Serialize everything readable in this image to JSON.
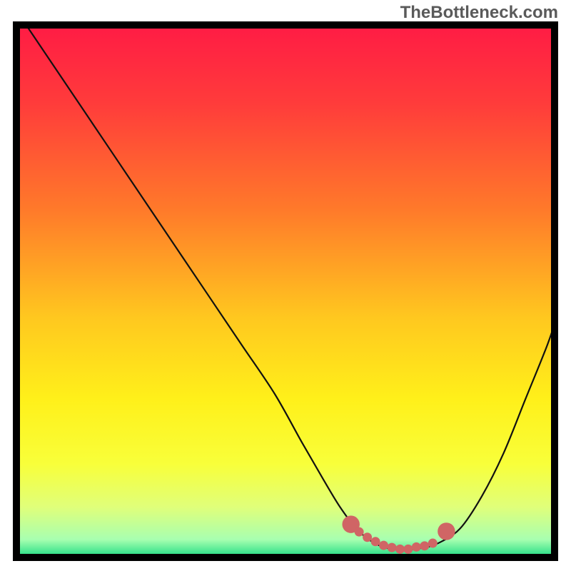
{
  "attribution": "TheBottleneck.com",
  "colors": {
    "gradient_stops": [
      {
        "offset": 0.0,
        "color": "#ff1a45"
      },
      {
        "offset": 0.15,
        "color": "#ff3b3b"
      },
      {
        "offset": 0.35,
        "color": "#ff7a2a"
      },
      {
        "offset": 0.55,
        "color": "#ffc81f"
      },
      {
        "offset": 0.7,
        "color": "#fff01a"
      },
      {
        "offset": 0.82,
        "color": "#f8ff3a"
      },
      {
        "offset": 0.9,
        "color": "#e0ff7a"
      },
      {
        "offset": 0.96,
        "color": "#a8ffb0"
      },
      {
        "offset": 1.0,
        "color": "#00d47a"
      }
    ],
    "frame": "#000000",
    "curve": "#111111",
    "marker": "#d06565",
    "marker_stroke": "#b24e4e"
  },
  "chart_data": {
    "type": "line",
    "title": "",
    "xlabel": "",
    "ylabel": "",
    "xlim": [
      0,
      100
    ],
    "ylim": [
      0,
      100
    ],
    "series": [
      {
        "name": "bottleneck-curve",
        "x": [
          2,
          6,
          12,
          18,
          24,
          30,
          36,
          42,
          48,
          53,
          57,
          60,
          63,
          66,
          69,
          72,
          75,
          78,
          82,
          86,
          90,
          94,
          98,
          100
        ],
        "y": [
          100,
          94,
          85,
          76,
          67,
          58,
          49,
          40,
          31,
          22,
          15,
          10,
          6,
          3.5,
          2.3,
          2.1,
          2.4,
          3.3,
          6,
          12,
          20,
          30,
          40,
          46
        ]
      }
    ],
    "markers": {
      "name": "optimal-range",
      "points": [
        {
          "x": 62.0,
          "y": 6.8
        },
        {
          "x": 63.5,
          "y": 5.4
        },
        {
          "x": 65.0,
          "y": 4.4
        },
        {
          "x": 66.5,
          "y": 3.6
        },
        {
          "x": 68.0,
          "y": 2.9
        },
        {
          "x": 69.5,
          "y": 2.5
        },
        {
          "x": 71.0,
          "y": 2.2
        },
        {
          "x": 72.5,
          "y": 2.2
        },
        {
          "x": 74.0,
          "y": 2.6
        },
        {
          "x": 75.5,
          "y": 2.8
        },
        {
          "x": 77.0,
          "y": 3.3
        },
        {
          "x": 79.5,
          "y": 5.5
        }
      ],
      "end_cap_left_radius": 1.6,
      "end_cap_right_radius": 1.6,
      "mid_radius": 0.85
    }
  }
}
